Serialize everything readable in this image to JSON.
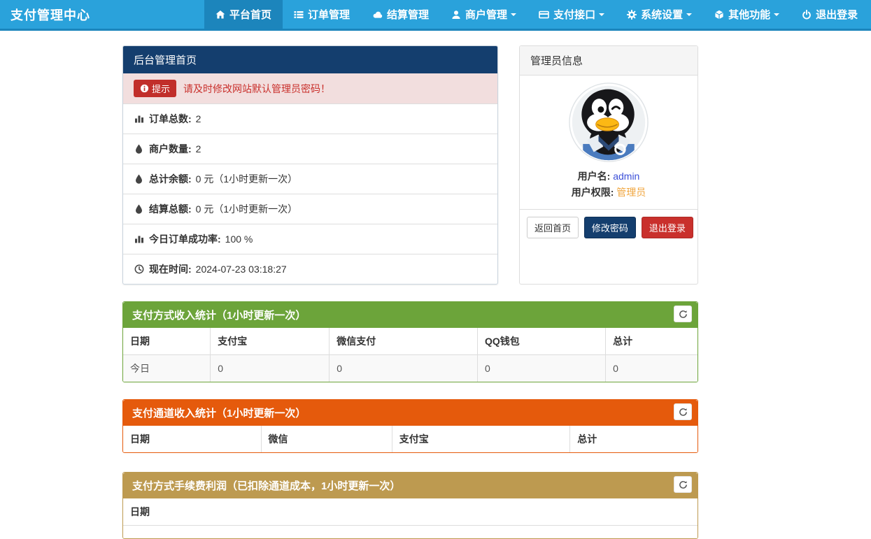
{
  "navbar": {
    "brand": "支付管理中心",
    "items": [
      {
        "label": "平台首页",
        "icon": "home-icon",
        "active": true,
        "dropdown": false
      },
      {
        "label": "订单管理",
        "icon": "list-icon",
        "active": false,
        "dropdown": false
      },
      {
        "label": "结算管理",
        "icon": "cloud-icon",
        "active": false,
        "dropdown": false
      },
      {
        "label": "商户管理",
        "icon": "user-icon",
        "active": false,
        "dropdown": true
      },
      {
        "label": "支付接口",
        "icon": "credit-card-icon",
        "active": false,
        "dropdown": true
      },
      {
        "label": "系统设置",
        "icon": "gear-icon",
        "active": false,
        "dropdown": true
      },
      {
        "label": "其他功能",
        "icon": "cube-icon",
        "active": false,
        "dropdown": true
      },
      {
        "label": "退出登录",
        "icon": "power-icon",
        "active": false,
        "dropdown": false
      }
    ]
  },
  "dashboard": {
    "title": "后台管理首页",
    "alert": {
      "badge": "提示",
      "message": "请及时修改网站默认管理员密码！"
    },
    "stats": [
      {
        "icon": "bar-chart-icon",
        "label": "订单总数:",
        "value": "2"
      },
      {
        "icon": "droplet-icon",
        "label": "商户数量:",
        "value": "2"
      },
      {
        "icon": "droplet-icon",
        "label": "总计余额:",
        "value": "0 元（1小时更新一次）"
      },
      {
        "icon": "droplet-icon",
        "label": "结算总额:",
        "value": "0 元（1小时更新一次）"
      },
      {
        "icon": "bar-chart-icon",
        "label": "今日订单成功率:",
        "value": "100 %"
      },
      {
        "icon": "clock-icon",
        "label": "现在时间:",
        "value": "2024-07-23 03:18:27"
      }
    ]
  },
  "admin": {
    "title": "管理员信息",
    "avatar": "qq-penguin-avatar",
    "username_label": "用户名:",
    "username": "admin",
    "role_label": "用户权限:",
    "role": "管理员",
    "buttons": [
      {
        "label": "返回首页",
        "style": "default"
      },
      {
        "label": "修改密码",
        "style": "navy"
      },
      {
        "label": "退出登录",
        "style": "red"
      }
    ]
  },
  "sections": [
    {
      "title": "支付方式收入统计（1小时更新一次）",
      "accent_color": "#6CA43A",
      "headers": [
        "日期",
        "支付宝",
        "微信支付",
        "QQ钱包",
        "总计"
      ],
      "rows": [
        [
          "今日",
          "0",
          "0",
          "0",
          "0"
        ]
      ]
    },
    {
      "title": "支付通道收入统计（1小时更新一次）",
      "accent_color": "#E55A0C",
      "headers": [
        "日期",
        "微信",
        "支付宝",
        "总计"
      ],
      "rows": []
    },
    {
      "title": "支付方式手续费利润（已扣除通道成本，1小时更新一次）",
      "accent_color": "#BD9A50",
      "headers": [
        "日期"
      ],
      "rows": []
    }
  ],
  "colors": {
    "navbar": "#2AA2DB",
    "navbar_active": "#1C85BC",
    "panel_header_navy": "#143E6E",
    "alert_bg": "#F2DEDE",
    "alert_text": "#C9302C",
    "badge_red": "#C12E2A",
    "link_blue": "#3B4FD8",
    "role_orange": "#F0A63F",
    "button_red": "#C9302C"
  }
}
